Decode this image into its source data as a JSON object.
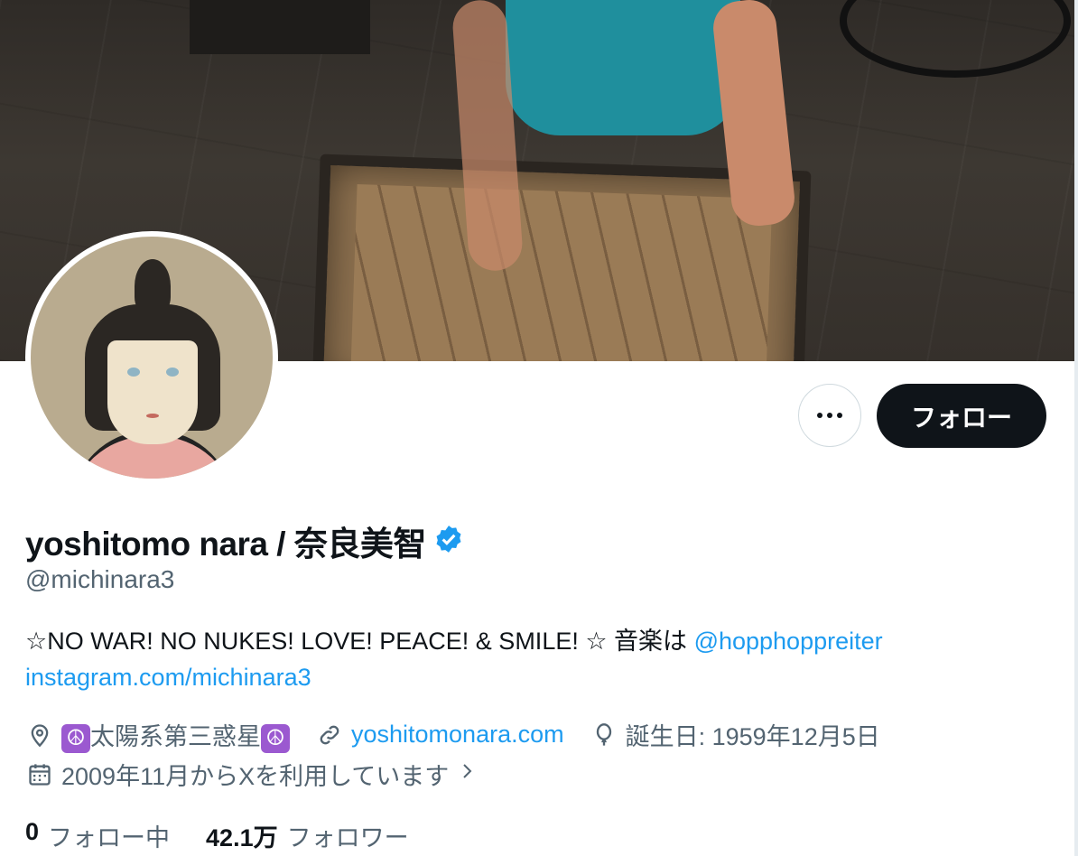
{
  "profile": {
    "display_name": "yoshitomo nara / 奈良美智",
    "handle": "@michinara3",
    "verified": true,
    "bio_text": "☆NO WAR! NO NUKES! LOVE! PEACE! & SMILE! ☆ 音楽は ",
    "bio_mention": "@hopphoppreiter",
    "bio_link": "instagram.com/michinara3",
    "location_text": "太陽系第三惑星",
    "location_emoji": "☮",
    "website": "yoshitomonara.com",
    "birthday": "誕生日: 1959年12月5日",
    "joined": "2009年11月からXを利用しています",
    "following_count": "0",
    "following_label": "フォロー中",
    "followers_count": "42.1万",
    "followers_label": "フォロワー"
  },
  "actions": {
    "follow_label": "フォロー",
    "more_icon": "more-icon"
  },
  "colors": {
    "accent": "#1d9bf0",
    "text": "#0f1419",
    "muted": "#536471",
    "follow_bg": "#0f1419"
  }
}
